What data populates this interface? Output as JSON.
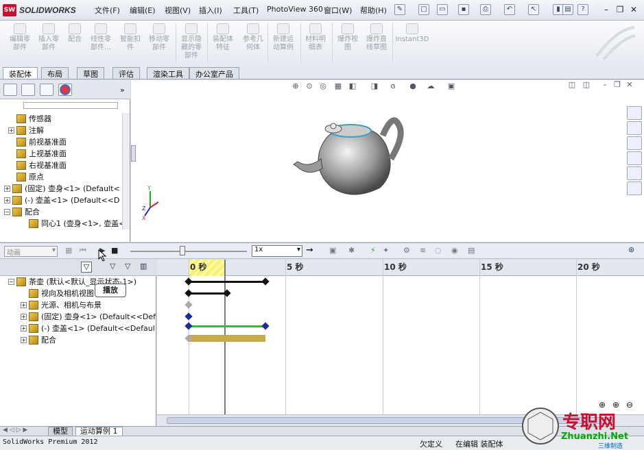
{
  "app": {
    "logo_text": "SOLIDWORKS",
    "logo_badge": "SW"
  },
  "menu": [
    "文件(F)",
    "编辑(E)",
    "视图(V)",
    "插入(I)",
    "工具(T)",
    "PhotoView 360",
    "窗口(W)",
    "帮助(H)"
  ],
  "commands": [
    {
      "label": "编辑零\n部件"
    },
    {
      "label": "插入零\n部件"
    },
    {
      "label": "配合"
    },
    {
      "label": "线性零\n部件…"
    },
    {
      "label": "智能扣\n件"
    },
    {
      "label": "移动零\n部件"
    },
    {
      "label": "显示隐\n藏的零\n部件"
    },
    {
      "label": "装配体\n特征"
    },
    {
      "label": "参考几\n何体"
    },
    {
      "label": "新建运\n动算例"
    },
    {
      "label": "材料明\n细表"
    },
    {
      "label": "爆炸视\n图"
    },
    {
      "label": "爆炸直\n线草图"
    },
    {
      "label": "Instant3D"
    }
  ],
  "tabs": [
    "装配体",
    "布局",
    "草图",
    "评估",
    "渲染工具",
    "办公室产品"
  ],
  "feature_tree": [
    {
      "label": "传感器",
      "expand": ""
    },
    {
      "label": "注解",
      "expand": "+"
    },
    {
      "label": "前视基准面",
      "expand": ""
    },
    {
      "label": "上视基准面",
      "expand": ""
    },
    {
      "label": "右视基准面",
      "expand": ""
    },
    {
      "label": "原点",
      "expand": ""
    },
    {
      "label": "(固定) 壶身<1> (Default<",
      "expand": "+"
    },
    {
      "label": "(-) 壶盖<1> (Default<<D",
      "expand": "+"
    },
    {
      "label": "配合",
      "expand": "−"
    },
    {
      "label": "同心1 (壶身<1>, 壶盖<",
      "expand": ""
    }
  ],
  "motion": {
    "study_type": "动画",
    "speed": "1x",
    "tooltip": "播放"
  },
  "timeline_ticks": [
    "0 秒",
    "5 秒",
    "10 秒",
    "15 秒",
    "20 秒"
  ],
  "motion_tree": [
    {
      "label": "茶壶  (默认<默认_显示状态-1>)",
      "expand": "−"
    },
    {
      "label": "视向及相机视图",
      "expand": ""
    },
    {
      "label": "光源、相机与布景",
      "expand": "+"
    },
    {
      "label": "(固定) 壶身<1> (Default<<Def",
      "expand": "+"
    },
    {
      "label": "(-) 壶盖<1> (Default<<Defaul",
      "expand": "+"
    },
    {
      "label": "配合",
      "expand": "+"
    }
  ],
  "bottom_tabs": [
    "模型",
    "运动算例 1"
  ],
  "status": {
    "left": "SolidWorks Premium 2012",
    "s1": "欠定义",
    "s2": "在编辑 装配体"
  },
  "watermark": {
    "title": "专职网",
    "url": "Zhuanzhi.Net",
    "sub": "三维制造"
  },
  "triad": {
    "x": "X",
    "y": "Y",
    "z": "Z"
  },
  "colors": {
    "accent_red": "#c8102e",
    "track_green": "#2fbf2f",
    "track_gold": "#c9a84a",
    "key_blue": "#1c2e9a",
    "time_band": "#f7f36a"
  }
}
